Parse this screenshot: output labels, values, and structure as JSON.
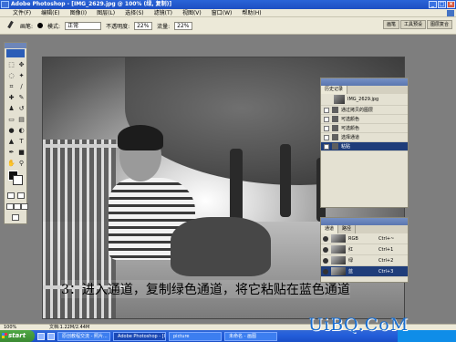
{
  "window": {
    "title": "Adobe Photoshop - [IMG_2629.jpg @ 100% (绿, 复制)]",
    "controls": [
      "_",
      "□",
      "×"
    ]
  },
  "menubar": {
    "items": [
      "文件(F)",
      "编辑(E)",
      "图像(I)",
      "图层(L)",
      "选择(S)",
      "滤镜(T)",
      "视图(V)",
      "窗口(W)",
      "帮助(H)"
    ]
  },
  "options": {
    "brush_label": "画笔:",
    "mode_label": "模式:",
    "mode_value": "正常",
    "opacity_label": "不透明度:",
    "opacity_value": "22%",
    "flow_label": "流量:",
    "flow_value": "22%",
    "wells": [
      "画笔",
      "工具预设",
      "图层复合"
    ]
  },
  "history": {
    "tabs": [
      "历史记录"
    ],
    "snapshot_name": "IMG_2629.jpg",
    "items": [
      {
        "label": "通过拷贝的图层",
        "selected": false
      },
      {
        "label": "可选颜色",
        "selected": false
      },
      {
        "label": "可选颜色",
        "selected": false
      },
      {
        "label": "选择通道",
        "selected": false
      },
      {
        "label": "粘贴",
        "selected": true
      }
    ]
  },
  "channels": {
    "tabs": [
      "通道",
      "路径"
    ],
    "rows": [
      {
        "name": "RGB",
        "shortcut": "Ctrl+~",
        "visible": true,
        "selected": false
      },
      {
        "name": "红",
        "shortcut": "Ctrl+1",
        "visible": true,
        "selected": false
      },
      {
        "name": "绿",
        "shortcut": "Ctrl+2",
        "visible": true,
        "selected": false
      },
      {
        "name": "蓝",
        "shortcut": "Ctrl+3",
        "visible": true,
        "selected": true
      }
    ]
  },
  "canvas": {
    "caption": "3：进入通道，复制绿色通道，将它粘贴在蓝色通道"
  },
  "status": {
    "zoom": "100%",
    "doc_size": "文档:1.22M/2.44M"
  },
  "taskbar": {
    "start_label": "start",
    "tasks": [
      {
        "label": "原创教程交流 - 照片...",
        "active": false
      },
      {
        "label": "Adobe Photoshop - [I...",
        "active": true
      },
      {
        "label": "picture",
        "active": false
      },
      {
        "label": "未命名 - 画图",
        "active": false
      }
    ]
  },
  "watermark": "UiBQ.CoM",
  "colors": {
    "titlebar": "#2a64d8",
    "selection": "#1f3d7a",
    "watermark": "#1a6fd1"
  }
}
